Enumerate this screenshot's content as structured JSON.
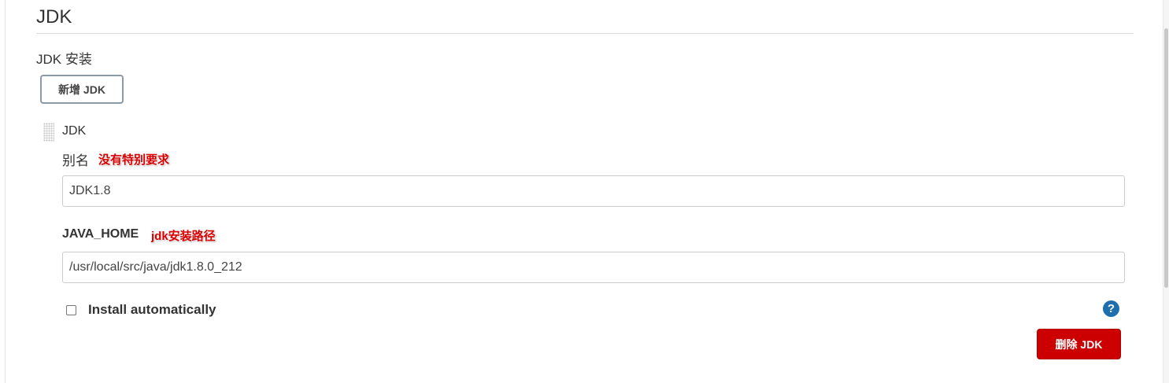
{
  "section": {
    "title": "JDK",
    "sub_label": "JDK 安装"
  },
  "buttons": {
    "add_label": "新增 JDK",
    "delete_label": "删除 JDK"
  },
  "jdk_block": {
    "title": "JDK",
    "alias_label": "别名",
    "alias_annotation": "没有特别要求",
    "alias_value": "JDK1.8",
    "java_home_label": "JAVA_HOME",
    "java_home_annotation": "jdk安装路径",
    "java_home_value": "/usr/local/src/java/jdk1.8.0_212",
    "install_auto_label": "Install automatically",
    "install_auto_checked": false
  },
  "icons": {
    "help": "help-icon",
    "drag": "drag-handle-icon"
  },
  "colors": {
    "delete_button": "#cc0000",
    "help_icon": "#1f6fae",
    "annotation": "#d80000"
  }
}
